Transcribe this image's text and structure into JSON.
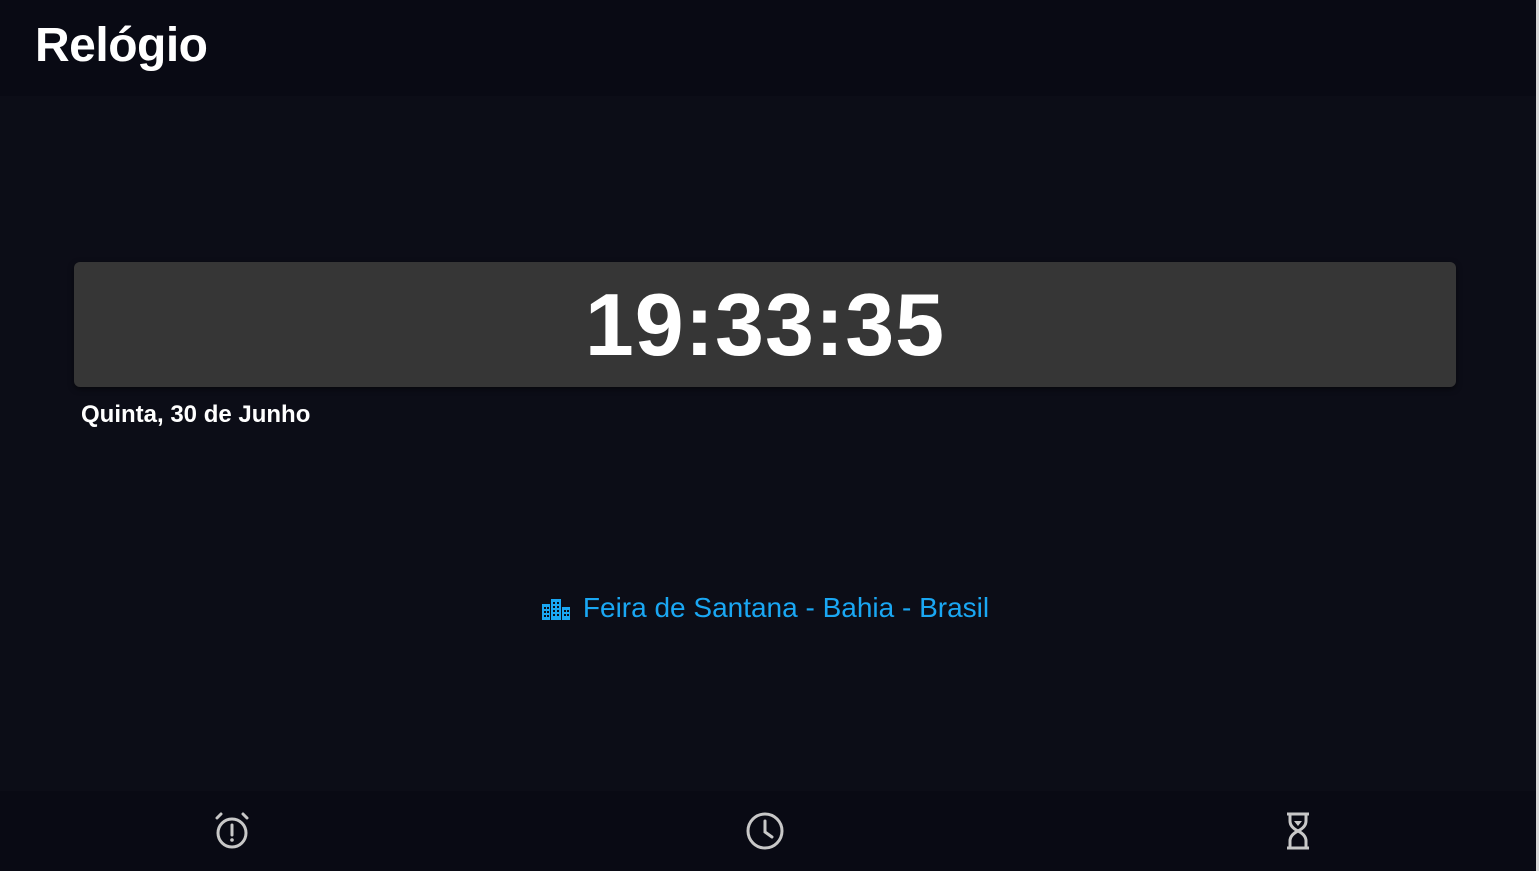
{
  "header": {
    "title": "Relógio"
  },
  "clock": {
    "time": "19:33:35",
    "date": "Quinta, 30 de Junho"
  },
  "location": {
    "icon": "city-icon",
    "text": "Feira de Santana - Bahia - Brasil",
    "color": "#1aa7f3"
  },
  "bottom_nav": {
    "items": [
      {
        "icon": "alarm-icon"
      },
      {
        "icon": "clock-icon"
      },
      {
        "icon": "hourglass-icon"
      }
    ],
    "icon_color": "#c8c8c8"
  },
  "colors": {
    "background": "#0c0d17",
    "header_background": "#090a14",
    "card_background": "#363636"
  }
}
